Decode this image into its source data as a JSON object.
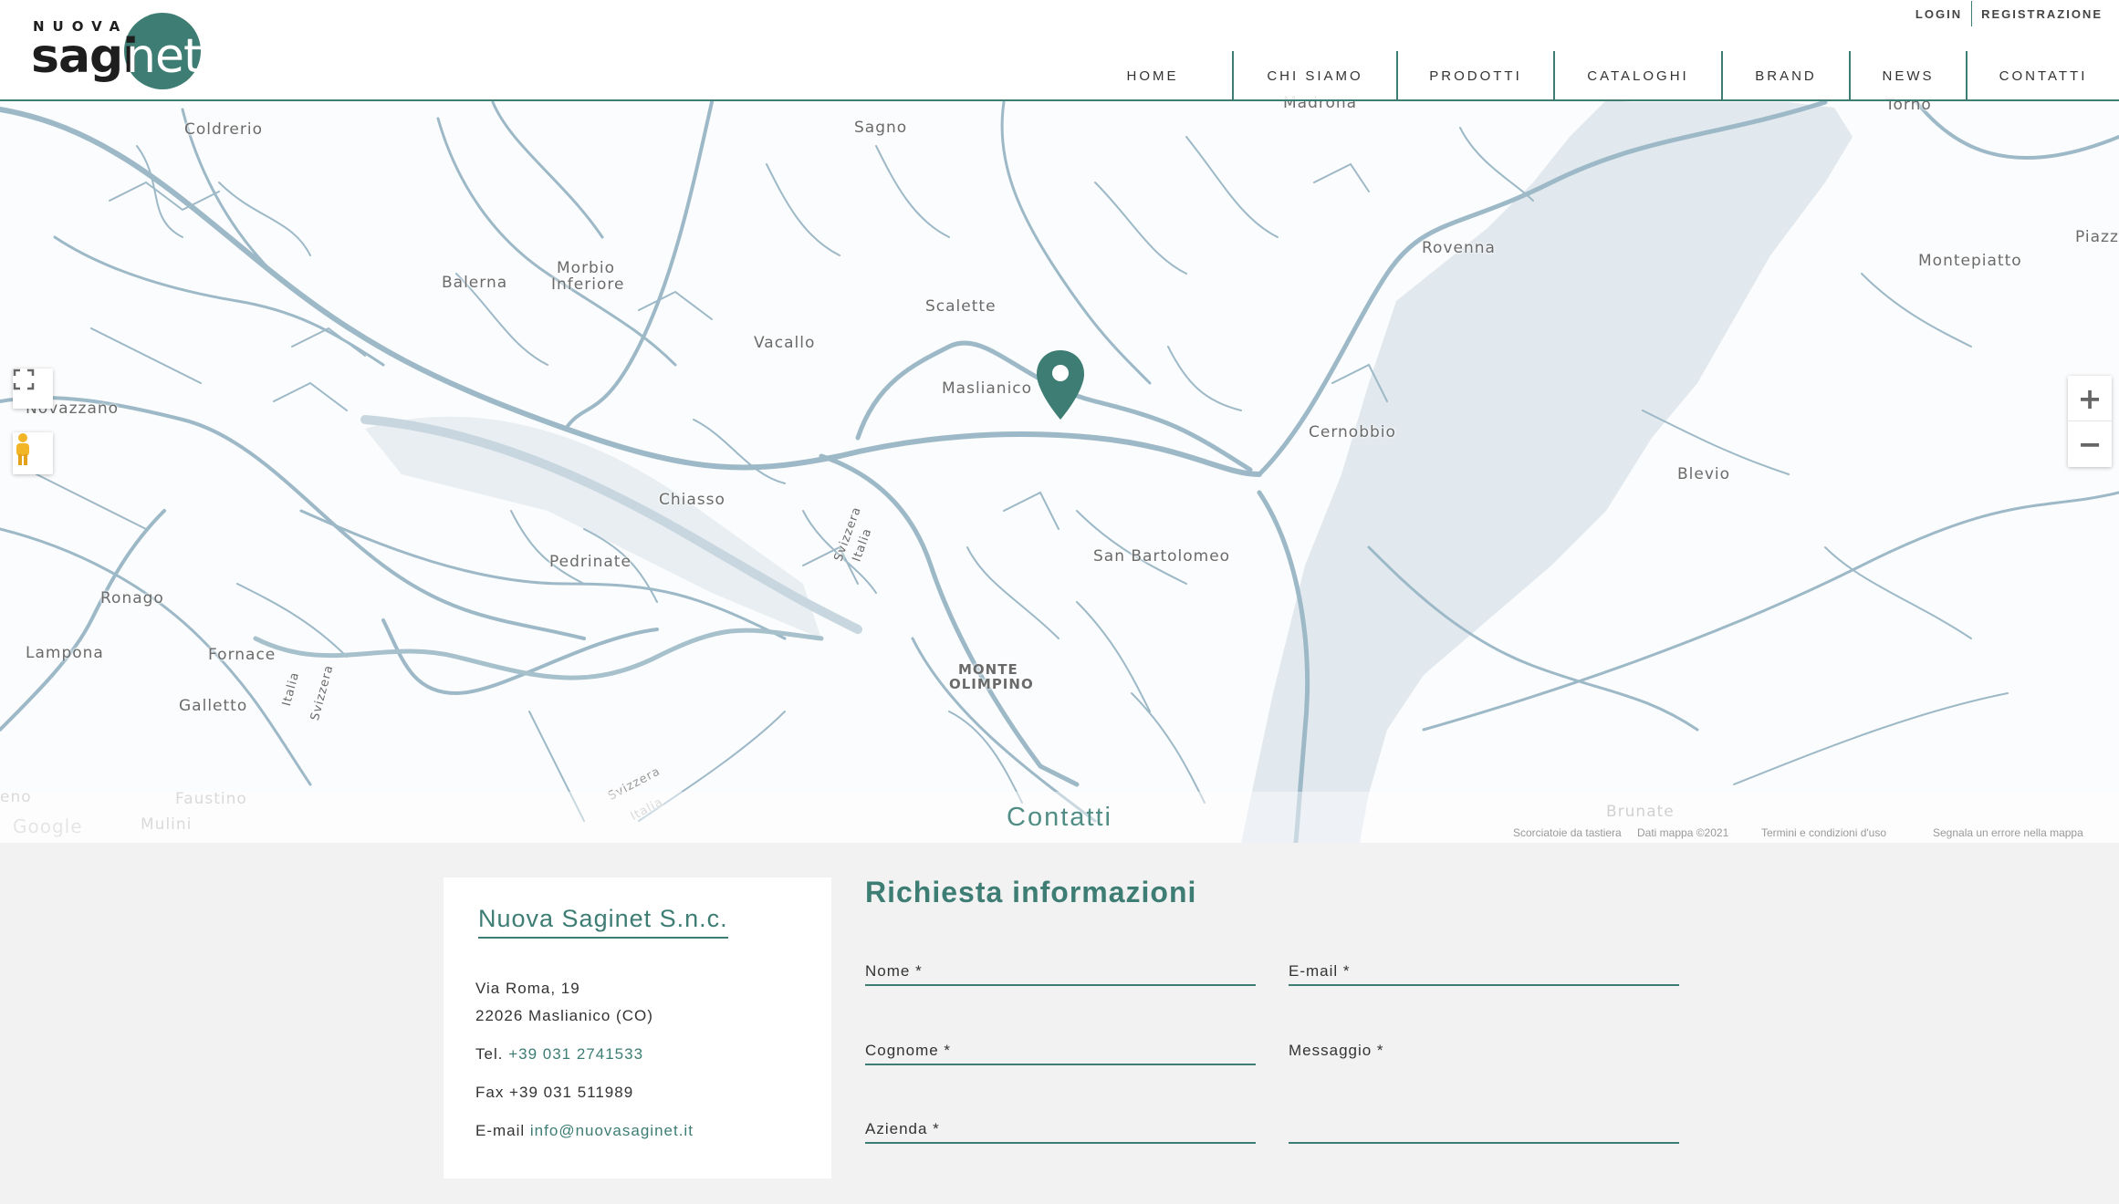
{
  "brand": {
    "nuova": "NUOVA",
    "sagi": "sagi",
    "net": "net",
    "accent_color": "#3d7d74"
  },
  "top_links": {
    "login": "LOGIN",
    "registrazione": "REGISTRAZIONE"
  },
  "nav": [
    "HOME",
    "CHI SIAMO",
    "PRODOTTI",
    "CATALOGHI",
    "BRAND",
    "NEWS",
    "CONTATTI"
  ],
  "map": {
    "labels": [
      "Coldrerio",
      "Sagno",
      "Madrona",
      "Torno",
      "Rovenna",
      "Montepiatto",
      "Piazza",
      "Balerna",
      "Morbio",
      "Inferiore",
      "Scalette",
      "Vacallo",
      "Maslianico",
      "Novazzano",
      "Cernobbio",
      "Blevio",
      "Chiasso",
      "Svizzera",
      "Italia",
      "Pedrinate",
      "San Bartolomeo",
      "Ronago",
      "Lampona",
      "Fornace",
      "Galletto",
      "Italia",
      "Svizzera",
      "MONTE",
      "OLIMPINO",
      "Faustino",
      "Mulini",
      "Svizzera",
      "Italia",
      "Brunate",
      "Google",
      "eno"
    ],
    "zoom_in": "+",
    "zoom_out": "−",
    "fullscreen_icon": "fullscreen-icon",
    "pegman_icon": "pegman-icon",
    "marker_icon": "map-marker-icon",
    "attribution": [
      "Scorciatoie da tastiera",
      "Dati mappa ©2021",
      "Termini e condizioni d'uso",
      "Segnala un errore nella mappa"
    ]
  },
  "section_title": "Contatti",
  "company": {
    "name": "Nuova Saginet S.n.c.",
    "address_1": "Via Roma, 19",
    "address_2": "22026 Maslianico (CO)",
    "tel_label": "Tel.",
    "tel": "+39 031 2741533",
    "fax": "Fax +39 031 511989",
    "email_label": "E-mail",
    "email": "info@nuovasaginet.it"
  },
  "form": {
    "title": "Richiesta informazioni",
    "nome": "Nome *",
    "email": "E-mail *",
    "cognome": "Cognome *",
    "messaggio": "Messaggio *",
    "azienda": "Azienda *"
  }
}
